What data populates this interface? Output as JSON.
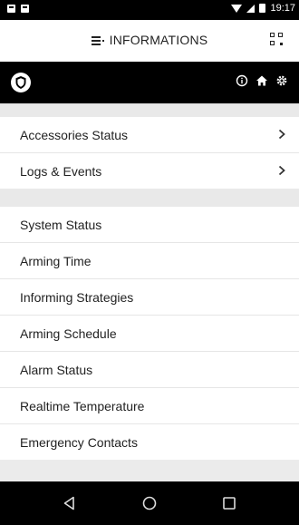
{
  "status_bar": {
    "time": "19:17"
  },
  "header": {
    "title": "INFORMATIONS"
  },
  "sections": [
    {
      "items": [
        {
          "label": "Accessories Status",
          "chevron": true
        },
        {
          "label": "Logs & Events",
          "chevron": true
        }
      ]
    },
    {
      "items": [
        {
          "label": "System Status",
          "chevron": false
        },
        {
          "label": "Arming Time",
          "chevron": false
        },
        {
          "label": "Informing Strategies",
          "chevron": false
        },
        {
          "label": "Arming Schedule",
          "chevron": false
        },
        {
          "label": "Alarm Status",
          "chevron": false
        },
        {
          "label": "Realtime Temperature",
          "chevron": false
        },
        {
          "label": "Emergency Contacts",
          "chevron": false
        }
      ]
    }
  ],
  "colors": {
    "toolbar": "#000000",
    "header": "#ffffff",
    "background": "#ebebeb",
    "text": "#222222"
  }
}
